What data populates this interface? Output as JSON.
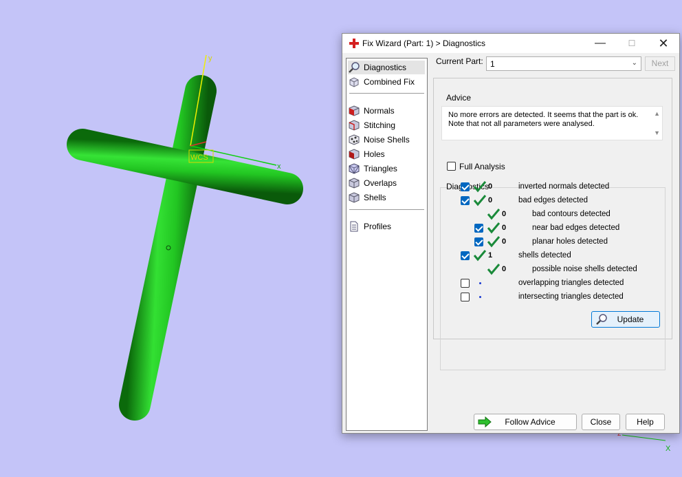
{
  "viewport": {
    "axis_y_label": "y",
    "axis_x_label": "x",
    "wcs_label": "WCS",
    "axis_z_label": "z",
    "axis_x2_label": "X",
    "part_color": "#22cc22"
  },
  "dialog": {
    "title": "Fix Wizard (Part: 1) > Diagnostics",
    "current_part_label": "Current Part:",
    "current_part_value": "1",
    "next_label": "Next",
    "nav": [
      {
        "label": "Diagnostics",
        "icon": "magnifier-icon"
      },
      {
        "label": "Combined Fix",
        "icon": "box-icon"
      },
      {
        "label": "Normals",
        "icon": "normals-cube-icon"
      },
      {
        "label": "Stitching",
        "icon": "stitching-cube-icon"
      },
      {
        "label": "Noise Shells",
        "icon": "noise-shells-icon"
      },
      {
        "label": "Holes",
        "icon": "holes-cube-icon"
      },
      {
        "label": "Triangles",
        "icon": "triangles-cube-icon"
      },
      {
        "label": "Overlaps",
        "icon": "overlaps-cube-icon"
      },
      {
        "label": "Shells",
        "icon": "shells-cube-icon"
      },
      {
        "label": "Profiles",
        "icon": "document-icon"
      }
    ],
    "advice": {
      "title": "Advice",
      "line1": "No more errors are detected. It seems that the part is ok.",
      "line2": "Note that not all parameters were analysed."
    },
    "diagnostics": {
      "title": "Diagnostics",
      "full_analysis": "Full Analysis",
      "rows": [
        {
          "count": "0",
          "label": "inverted normals detected",
          "checked": true
        },
        {
          "count": "0",
          "label": "bad edges detected",
          "checked": true
        },
        {
          "count": "0",
          "label": "bad contours detected"
        },
        {
          "count": "0",
          "label": "near bad edges detected",
          "checked": true
        },
        {
          "count": "0",
          "label": "planar holes detected",
          "checked": true
        },
        {
          "count": "1",
          "label": "shells detected",
          "checked": true
        },
        {
          "count": "0",
          "label": "possible noise shells detected"
        },
        {
          "count": "",
          "label": "overlapping triangles detected",
          "checked": false
        },
        {
          "count": "",
          "label": "intersecting triangles detected",
          "checked": false
        }
      ]
    },
    "update_label": "Update",
    "follow_label": "Follow Advice",
    "close_label": "Close",
    "help_label": "Help"
  }
}
